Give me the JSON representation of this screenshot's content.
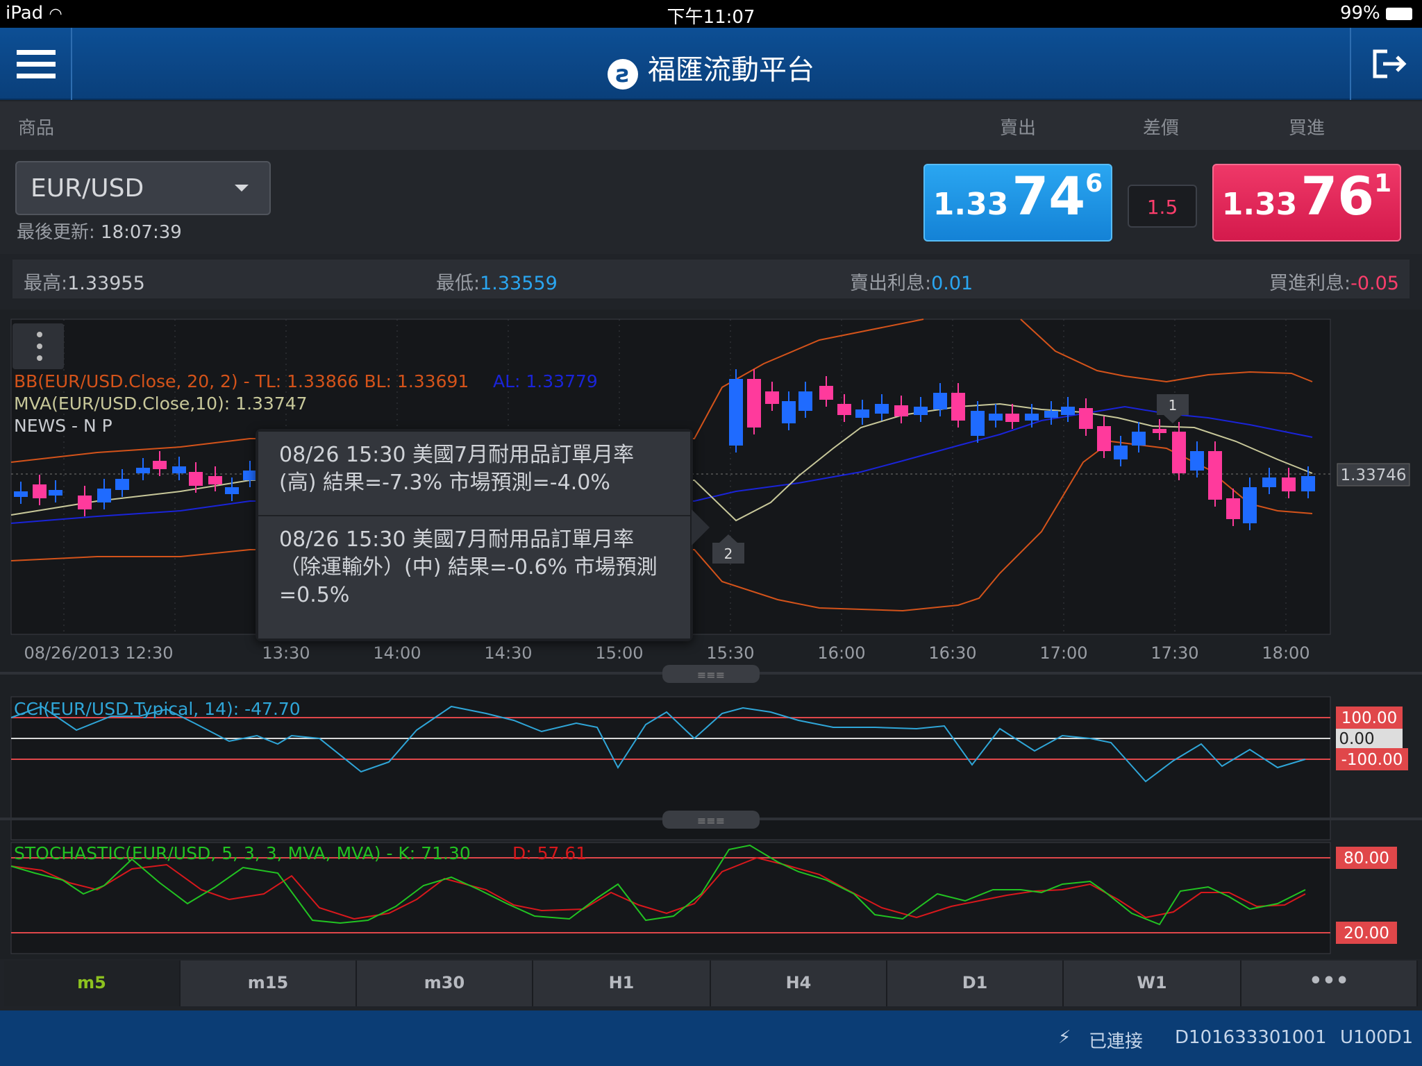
{
  "status": {
    "device": "iPad",
    "time": "下午11:07",
    "battery": "99%"
  },
  "app": {
    "title": "福匯流動平台"
  },
  "header": {
    "product": "商品",
    "sell": "賣出",
    "spread": "差價",
    "buy": "買進"
  },
  "quote": {
    "symbol": "EUR/USD",
    "updated_label": "最後更新:",
    "updated_time": "18:07:39",
    "sell": {
      "small": "1.33",
      "big": "74",
      "tiny": "6"
    },
    "spread": "1.5",
    "buy": {
      "small": "1.33",
      "big": "76",
      "tiny": "1"
    }
  },
  "stats": {
    "high_label": "最高:",
    "high": "1.33955",
    "low_label": "最低:",
    "low": "1.33559",
    "sell_int_label": "賣出利息:",
    "sell_int": "0.01",
    "buy_int_label": "買進利息:",
    "buy_int": "-0.05"
  },
  "indicators": {
    "bb_main": "BB(EUR/USD.Close, 20, 2) - TL: 1.33866 BL: 1.33691",
    "bb_al": "AL: 1.33779",
    "mva": "MVA(EUR/USD.Close,10): 1.33747",
    "news": "NEWS - N P",
    "cci": "CCI(EUR/USD.Typical, 14): -47.70",
    "stoch_main": "STOCHASTIC(EUR/USD, 5, 3, 3, MVA, MVA) - K: 71.30",
    "stoch_d": "D: 57.61"
  },
  "price_axis_label": "1.33746",
  "cci_levels": [
    "100.00",
    "0.00",
    "-100.00"
  ],
  "stoch_levels": [
    "80.00",
    "20.00"
  ],
  "news_markers": [
    "1",
    "2"
  ],
  "x_labels": [
    "08/26/2013  12:30",
    "13:30",
    "14:00",
    "14:30",
    "15:00",
    "15:30",
    "16:00",
    "16:30",
    "17:00",
    "17:30",
    "18:00"
  ],
  "popup": {
    "item1": "08/26 15:30 美國7月耐用品訂單月率 (高) 結果=-7.3% 市場預測=-4.0%",
    "item2": "08/26 15:30 美國7月耐用品訂單月率（除運輸外）(中) 結果=-0.6% 市場預測=0.5%"
  },
  "timeframes": [
    "m5",
    "m15",
    "m30",
    "H1",
    "H4",
    "D1",
    "W1",
    "•••"
  ],
  "footer": {
    "connected": "已連接",
    "account": "D101633301001",
    "user": "U100D1"
  },
  "colors": {
    "sell": "#1e8fe0",
    "buy": "#e02356",
    "bull": "#1f6bff",
    "bear": "#ff3a9c",
    "bb": "#d4531a",
    "mva": "#c8c89a",
    "al": "#1a24d9",
    "cci": "#2fa6d8",
    "stoch_k": "#22c322",
    "stoch_d": "#d8181c"
  },
  "chart_data": [
    {
      "type": "candlestick",
      "title": "EUR/USD m5",
      "ylabel": "",
      "note": "price chart with BB and MVA"
    },
    {
      "type": "line",
      "title": "CCI(EUR/USD.Typical, 14)",
      "levels": [
        100,
        0,
        -100
      ]
    },
    {
      "type": "line",
      "title": "STOCHASTIC(EUR/USD, 5, 3, 3, MVA, MVA)",
      "levels": [
        80,
        20
      ],
      "series": [
        {
          "name": "K",
          "last": 71.3
        },
        {
          "name": "D",
          "last": 57.61
        }
      ]
    }
  ]
}
